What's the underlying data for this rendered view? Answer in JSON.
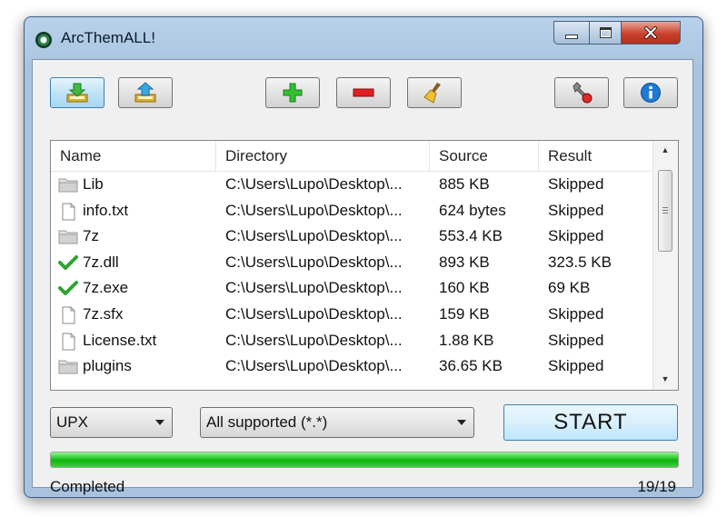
{
  "window": {
    "title": "ArcThemALL!"
  },
  "toolbar": {
    "extract_icon": "extract-icon",
    "compress_icon": "compress-icon",
    "add_icon": "add-icon",
    "remove_icon": "remove-icon",
    "clear_icon": "clear-icon",
    "settings_icon": "settings-icon",
    "about_icon": "info-icon"
  },
  "list": {
    "columns": [
      "Name",
      "Directory",
      "Source",
      "Result"
    ],
    "rows": [
      {
        "type": "folder",
        "name": "Lib",
        "dir": "C:\\Users\\Lupo\\Desktop\\...",
        "source": "885 KB",
        "result": "Skipped"
      },
      {
        "type": "file",
        "name": "info.txt",
        "dir": "C:\\Users\\Lupo\\Desktop\\...",
        "source": "624 bytes",
        "result": "Skipped"
      },
      {
        "type": "folder",
        "name": "7z",
        "dir": "C:\\Users\\Lupo\\Desktop\\...",
        "source": "553.4 KB",
        "result": "Skipped"
      },
      {
        "type": "check",
        "name": "7z.dll",
        "dir": "C:\\Users\\Lupo\\Desktop\\...",
        "source": "893 KB",
        "result": "323.5 KB"
      },
      {
        "type": "check",
        "name": "7z.exe",
        "dir": "C:\\Users\\Lupo\\Desktop\\...",
        "source": "160 KB",
        "result": "69 KB"
      },
      {
        "type": "file",
        "name": "7z.sfx",
        "dir": "C:\\Users\\Lupo\\Desktop\\...",
        "source": "159 KB",
        "result": "Skipped"
      },
      {
        "type": "file",
        "name": "License.txt",
        "dir": "C:\\Users\\Lupo\\Desktop\\...",
        "source": "1.88 KB",
        "result": "Skipped"
      },
      {
        "type": "folder",
        "name": "plugins",
        "dir": "C:\\Users\\Lupo\\Desktop\\...",
        "source": "36.65 KB",
        "result": "Skipped"
      }
    ]
  },
  "controls": {
    "method": "UPX",
    "filter": "All supported (*.*)",
    "start_label": "START"
  },
  "progress": {
    "fraction": 1.0
  },
  "status": {
    "text": "Completed",
    "count": "19/19"
  },
  "colors": {
    "progress": "#16b816",
    "check": "#2fa32f",
    "close": "#c8412c"
  }
}
